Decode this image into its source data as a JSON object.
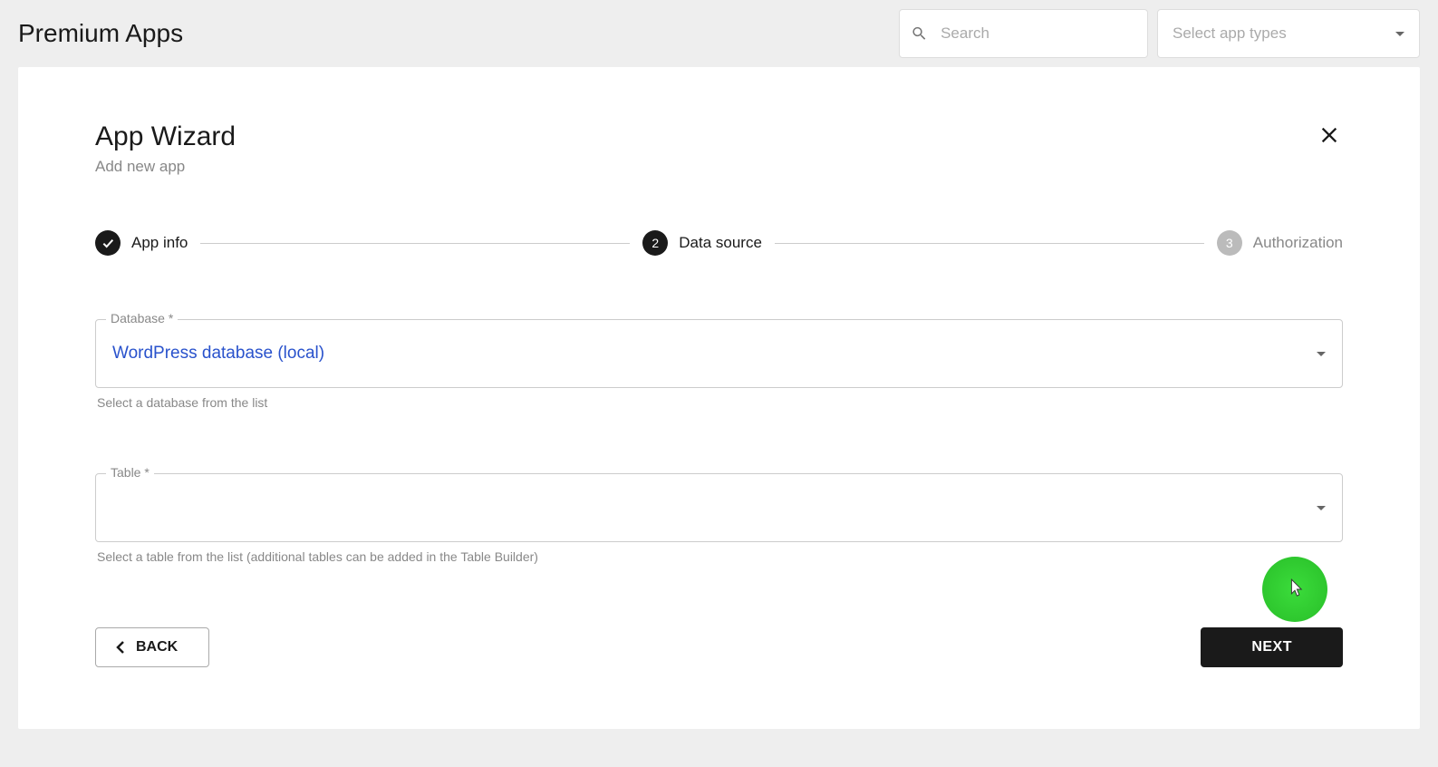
{
  "header": {
    "title": "Premium Apps",
    "search_placeholder": "Search",
    "select_types_placeholder": "Select app types"
  },
  "wizard": {
    "title": "App Wizard",
    "subtitle": "Add new app",
    "steps": {
      "s1": "App info",
      "s2_num": "2",
      "s2": "Data source",
      "s3_num": "3",
      "s3": "Authorization"
    },
    "database": {
      "label": "Database *",
      "value": "WordPress database (local)",
      "helper": "Select a database from the list"
    },
    "table": {
      "label": "Table *",
      "value": "",
      "helper": "Select a table from the list (additional tables can be added in the Table Builder)"
    },
    "buttons": {
      "back": "BACK",
      "next": "NEXT"
    }
  }
}
